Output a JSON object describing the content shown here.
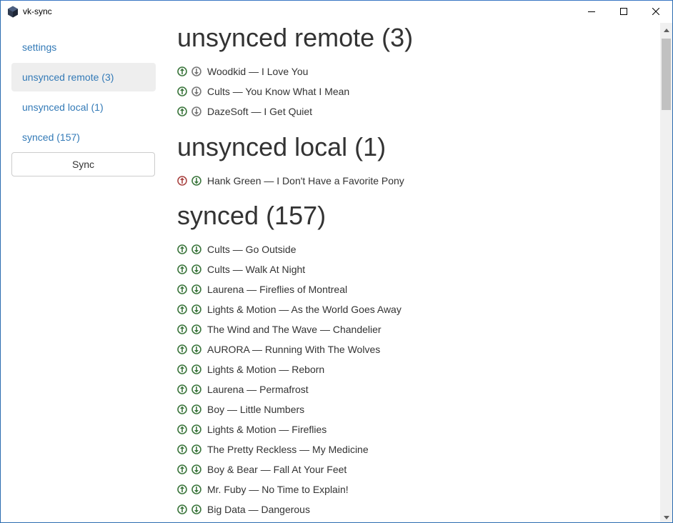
{
  "window": {
    "title": "vk-sync",
    "controls": [
      "minimize-icon",
      "maximize-icon",
      "close-icon"
    ]
  },
  "sidebar": {
    "items": [
      {
        "label": "settings",
        "active": false
      },
      {
        "label": "unsynced remote (3)",
        "active": true
      },
      {
        "label": "unsynced local (1)",
        "active": false
      },
      {
        "label": "synced (157)",
        "active": false
      }
    ],
    "sync_button": "Sync"
  },
  "colors": {
    "link": "#337ab7",
    "active_nav_bg": "#eeeeee",
    "icon_green": "#3c763d",
    "icon_red": "#a94442",
    "icon_gray": "#777777"
  },
  "sections": [
    {
      "title": "unsynced remote (3)",
      "tracks": [
        {
          "text": "Woodkid — I Love You",
          "upload": "green",
          "download": "gray"
        },
        {
          "text": "Cults — You Know What I Mean",
          "upload": "green",
          "download": "gray"
        },
        {
          "text": "DazeSoft — I Get Quiet",
          "upload": "green",
          "download": "gray"
        }
      ]
    },
    {
      "title": "unsynced local (1)",
      "tracks": [
        {
          "text": "Hank Green — I Don't Have a Favorite Pony",
          "upload": "red",
          "download": "green"
        }
      ]
    },
    {
      "title": "synced (157)",
      "tracks": [
        {
          "text": "Cults — Go Outside",
          "upload": "green",
          "download": "green"
        },
        {
          "text": "Cults — Walk At Night",
          "upload": "green",
          "download": "green"
        },
        {
          "text": "Laurena — Fireflies of Montreal",
          "upload": "green",
          "download": "green"
        },
        {
          "text": "Lights & Motion — As the World Goes Away",
          "upload": "green",
          "download": "green"
        },
        {
          "text": "The Wind and The Wave — Chandelier",
          "upload": "green",
          "download": "green"
        },
        {
          "text": "AURORA — Running With The Wolves",
          "upload": "green",
          "download": "green"
        },
        {
          "text": "Lights & Motion — Reborn",
          "upload": "green",
          "download": "green"
        },
        {
          "text": "Laurena — Permafrost",
          "upload": "green",
          "download": "green"
        },
        {
          "text": "Boy — Little Numbers",
          "upload": "green",
          "download": "green"
        },
        {
          "text": "Lights & Motion — Fireflies",
          "upload": "green",
          "download": "green"
        },
        {
          "text": "The Pretty Reckless — My Medicine",
          "upload": "green",
          "download": "green"
        },
        {
          "text": "Boy & Bear — Fall At Your Feet",
          "upload": "green",
          "download": "green"
        },
        {
          "text": "Mr. Fuby — No Time to Explain!",
          "upload": "green",
          "download": "green"
        },
        {
          "text": "Big Data — Dangerous",
          "upload": "green",
          "download": "green"
        },
        {
          "text": "",
          "upload": "green",
          "download": "green"
        }
      ]
    }
  ]
}
